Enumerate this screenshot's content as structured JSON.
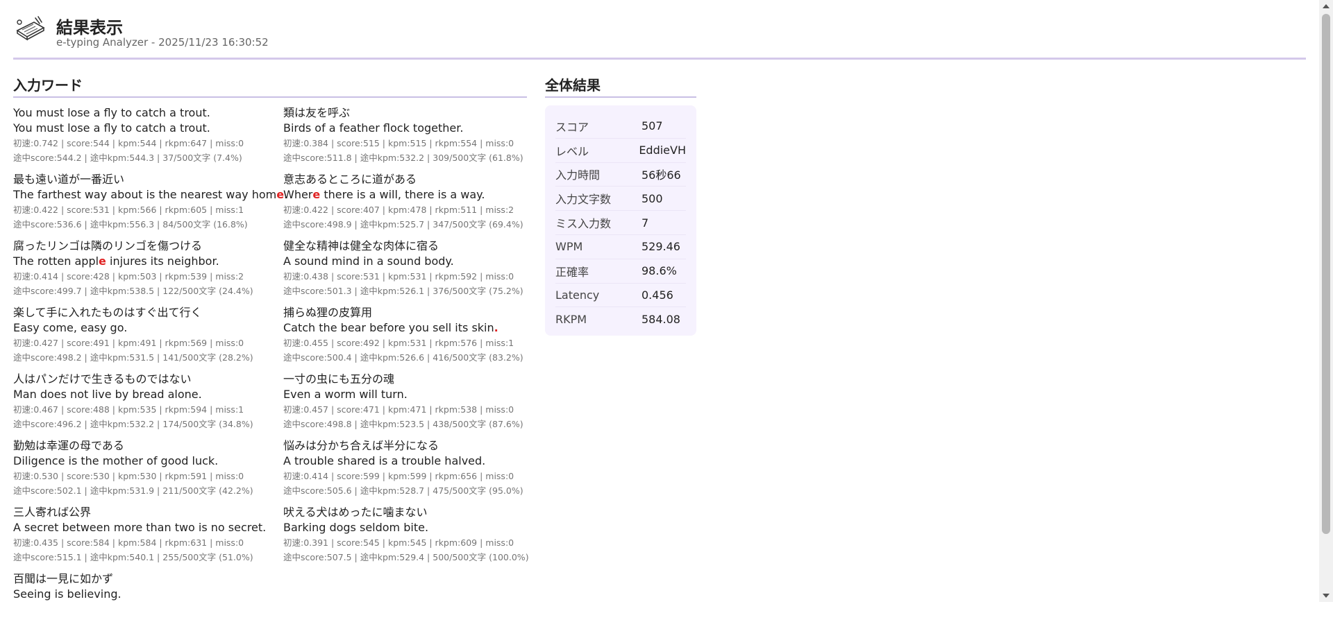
{
  "header": {
    "title": "結果表示",
    "subtitle": "e-typing Analyzer - 2025/11/23 16:30:52",
    "logo_icon": "laptop-typing-icon"
  },
  "words_section": {
    "title": "入力ワード",
    "entries": [
      {
        "jp": "You must lose a fly to catch a trout.",
        "en_pre": "You must lose a fly to catch a trout.",
        "en_miss": "",
        "en_post": "",
        "m1": "初速:0.742 | score:544 | kpm:544 | rkpm:647 | miss:0",
        "m2": "途中score:544.2 | 途中kpm:544.3 | 37/500文字 (7.4%)"
      },
      {
        "jp": "類は友を呼ぶ",
        "en_pre": "Birds of a feather flock together.",
        "en_miss": "",
        "en_post": "",
        "m1": "初速:0.384 | score:515 | kpm:515 | rkpm:554 | miss:0",
        "m2": "途中score:511.8 | 途中kpm:532.2 | 309/500文字 (61.8%)"
      },
      {
        "jp": "最も遠い道が一番近い",
        "en_pre": "The farthest way about is the nearest way hom",
        "en_miss": "e",
        "en_post": ".",
        "m1": "初速:0.422 | score:531 | kpm:566 | rkpm:605 | miss:1",
        "m2": "途中score:536.6 | 途中kpm:556.3 | 84/500文字 (16.8%)"
      },
      {
        "jp": "意志あるところに道がある",
        "en_pre": "Wher",
        "en_miss": "e",
        "en_post": " there is a will, there is a way.",
        "m1": "初速:0.422 | score:407 | kpm:478 | rkpm:511 | miss:2",
        "m2": "途中score:498.9 | 途中kpm:525.7 | 347/500文字 (69.4%)"
      },
      {
        "jp": "腐ったリンゴは隣のリンゴを傷つける",
        "en_pre": "The rotten appl",
        "en_miss": "e",
        "en_post": " injures its neighbor.",
        "m1": "初速:0.414 | score:428 | kpm:503 | rkpm:539 | miss:2",
        "m2": "途中score:499.7 | 途中kpm:538.5 | 122/500文字 (24.4%)"
      },
      {
        "jp": "健全な精神は健全な肉体に宿る",
        "en_pre": "A sound mind in a sound body.",
        "en_miss": "",
        "en_post": "",
        "m1": "初速:0.438 | score:531 | kpm:531 | rkpm:592 | miss:0",
        "m2": "途中score:501.3 | 途中kpm:526.1 | 376/500文字 (75.2%)"
      },
      {
        "jp": "楽して手に入れたものはすぐ出て行く",
        "en_pre": "Easy come, easy go.",
        "en_miss": "",
        "en_post": "",
        "m1": "初速:0.427 | score:491 | kpm:491 | rkpm:569 | miss:0",
        "m2": "途中score:498.2 | 途中kpm:531.5 | 141/500文字 (28.2%)"
      },
      {
        "jp": "捕らぬ狸の皮算用",
        "en_pre": "Catch the bear before you sell its skin",
        "en_miss": ".",
        "en_post": "",
        "m1": "初速:0.455 | score:492 | kpm:531 | rkpm:576 | miss:1",
        "m2": "途中score:500.4 | 途中kpm:526.6 | 416/500文字 (83.2%)"
      },
      {
        "jp": "人はパンだけで生きるものではない",
        "en_pre": "Man does not live by bread alone.",
        "en_miss": "",
        "en_post": "",
        "m1": "初速:0.467 | score:488 | kpm:535 | rkpm:594 | miss:1",
        "m2": "途中score:496.2 | 途中kpm:532.2 | 174/500文字 (34.8%)"
      },
      {
        "jp": "一寸の虫にも五分の魂",
        "en_pre": "Even a worm will turn.",
        "en_miss": "",
        "en_post": "",
        "m1": "初速:0.457 | score:471 | kpm:471 | rkpm:538 | miss:0",
        "m2": "途中score:498.8 | 途中kpm:523.5 | 438/500文字 (87.6%)"
      },
      {
        "jp": "勤勉は幸運の母である",
        "en_pre": "Diligence is the mother of good luck.",
        "en_miss": "",
        "en_post": "",
        "m1": "初速:0.530 | score:530 | kpm:530 | rkpm:591 | miss:0",
        "m2": "途中score:502.1 | 途中kpm:531.9 | 211/500文字 (42.2%)"
      },
      {
        "jp": "悩みは分かち合えば半分になる",
        "en_pre": "A trouble shared is a trouble halved.",
        "en_miss": "",
        "en_post": "",
        "m1": "初速:0.414 | score:599 | kpm:599 | rkpm:656 | miss:0",
        "m2": "途中score:505.6 | 途中kpm:528.7 | 475/500文字 (95.0%)"
      },
      {
        "jp": "三人寄れば公界",
        "en_pre": "A secret between more than two is no secret.",
        "en_miss": "",
        "en_post": "",
        "m1": "初速:0.435 | score:584 | kpm:584 | rkpm:631 | miss:0",
        "m2": "途中score:515.1 | 途中kpm:540.1 | 255/500文字 (51.0%)"
      },
      {
        "jp": "吠える犬はめったに噛まない",
        "en_pre": "Barking dogs seldom bite.",
        "en_miss": "",
        "en_post": "",
        "m1": "初速:0.391 | score:545 | kpm:545 | rkpm:609 | miss:0",
        "m2": "途中score:507.5 | 途中kpm:529.4 | 500/500文字 (100.0%)"
      },
      {
        "jp": "百聞は一見に如かず",
        "en_pre": "Seeing is believing.",
        "en_miss": "",
        "en_post": "",
        "m1": "",
        "m2": ""
      }
    ]
  },
  "summary": {
    "title": "全体結果",
    "rows": [
      {
        "label": "スコア",
        "value": "507"
      },
      {
        "label": "レベル",
        "value": "EddieVH"
      },
      {
        "label": "入力時間",
        "value": "56秒66"
      },
      {
        "label": "入力文字数",
        "value": "500"
      },
      {
        "label": "ミス入力数",
        "value": "7"
      },
      {
        "label": "WPM",
        "value": "529.46"
      },
      {
        "label": "正確率",
        "value": "98.6%"
      },
      {
        "label": "Latency",
        "value": "0.456"
      },
      {
        "label": "RKPM",
        "value": "584.08"
      }
    ]
  },
  "colors": {
    "accent_rule": "#d4c8ea",
    "miss": "#e02424",
    "summary_bg": "#f6f2fe"
  }
}
